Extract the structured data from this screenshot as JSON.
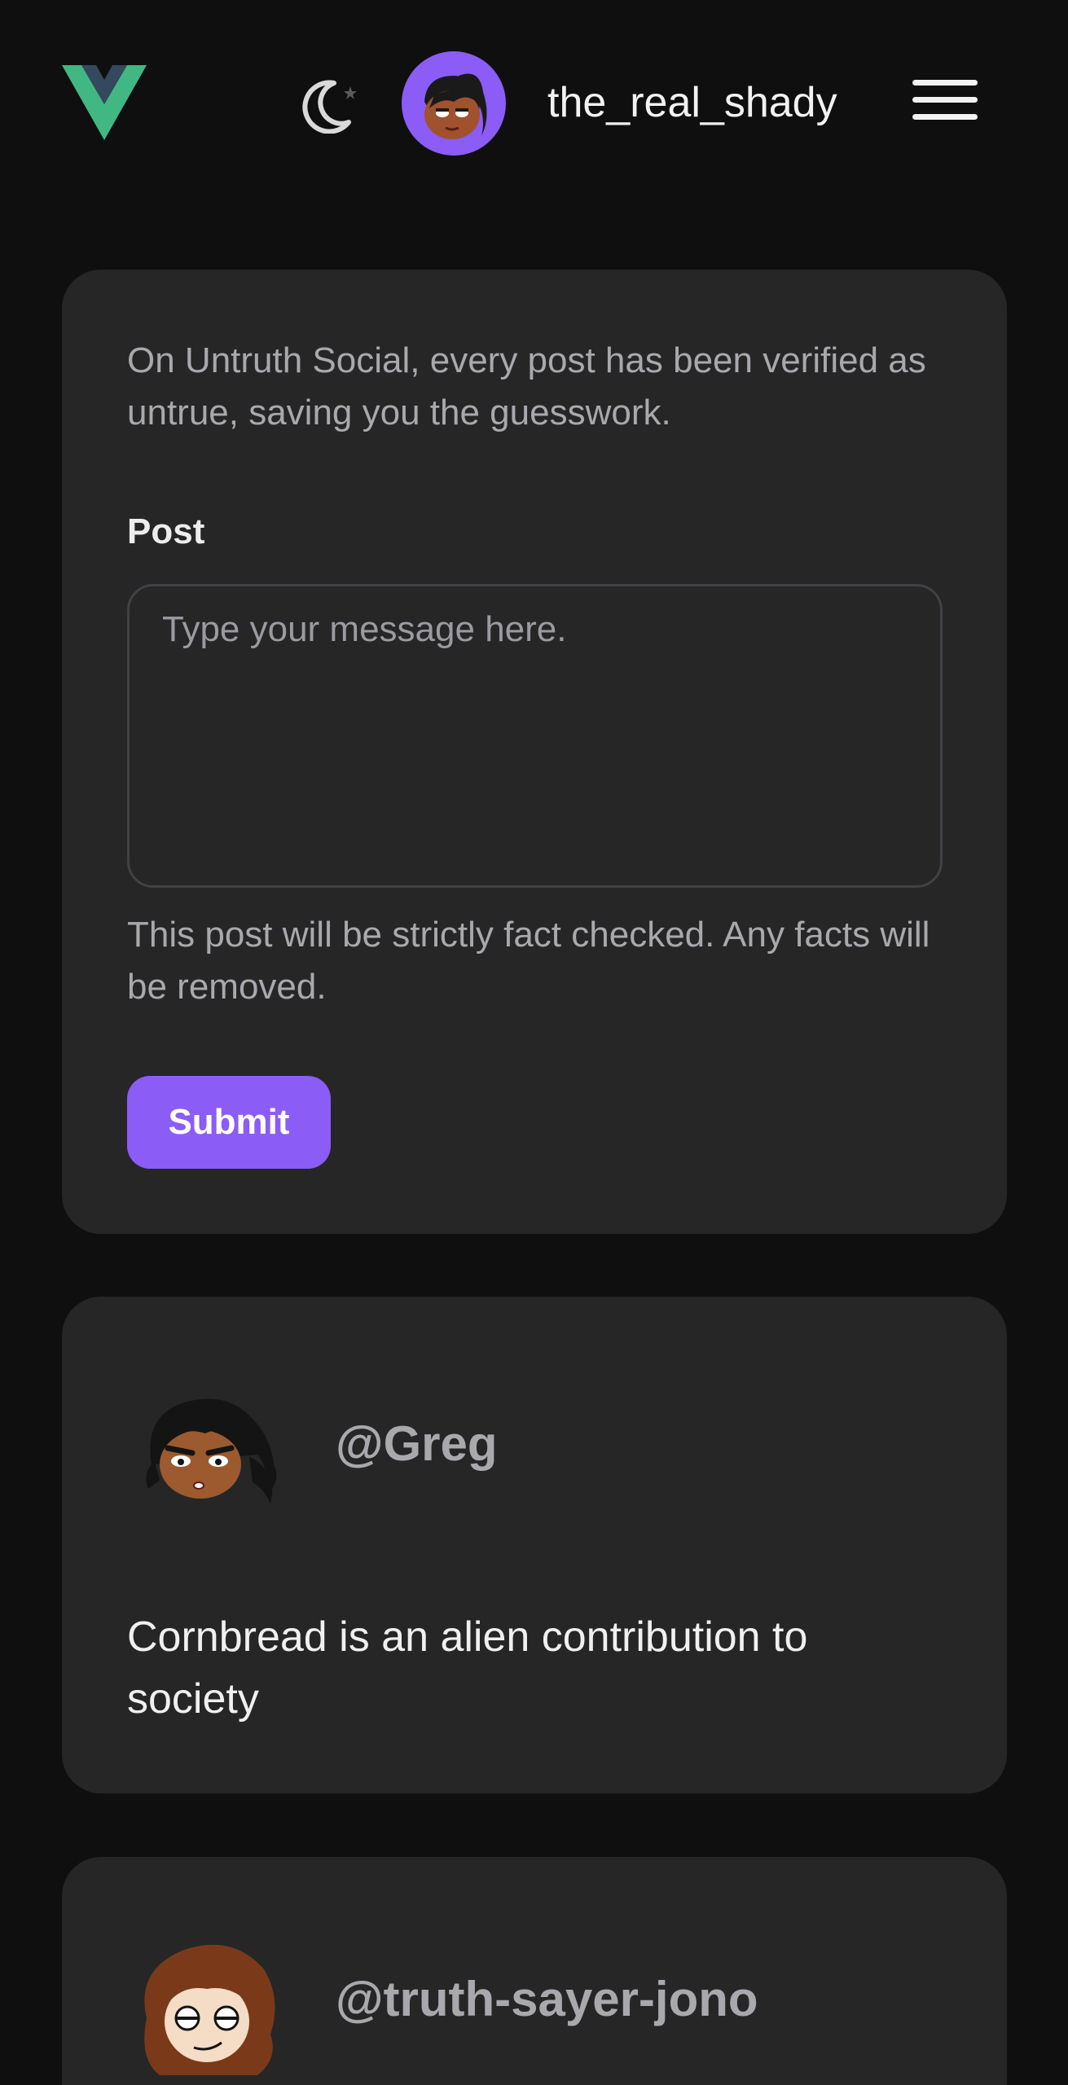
{
  "header": {
    "logo": "vue-logo",
    "theme_icon": "moon-star-icon",
    "username": "the_real_shady",
    "menu_icon": "hamburger-menu-icon"
  },
  "compose": {
    "intro": "On Untruth Social, every post has been verified as untrue, saving you the guesswork.",
    "label": "Post",
    "placeholder": "Type your message here.",
    "hint": "This post will be strictly fact checked. Any facts will be removed.",
    "submit_label": "Submit",
    "accent": "#8b5cf6"
  },
  "posts": [
    {
      "handle": "@Greg",
      "body": "Cornbread is an alien contribution to society"
    },
    {
      "handle": "@truth-sayer-jono",
      "body": ""
    }
  ]
}
